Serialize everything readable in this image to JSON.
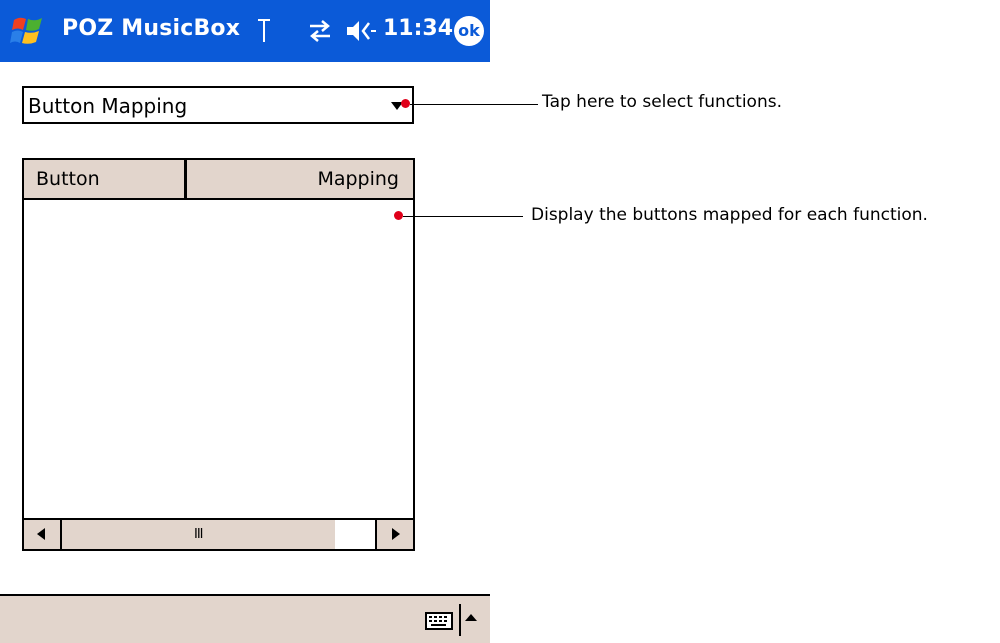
{
  "titlebar": {
    "app_title": "POZ MusicBox",
    "clock": "11:34",
    "ok_label": "ok",
    "icons": [
      "windows-start-icon",
      "antenna-icon",
      "connection-icon",
      "speaker-icon"
    ]
  },
  "function_select": {
    "selected": "Button Mapping"
  },
  "list": {
    "columns": [
      "Button",
      "Mapping"
    ],
    "rows": []
  },
  "scrollbar": {
    "grip": "III"
  },
  "menubar": {
    "icons": [
      "keyboard-icon",
      "sip-arrow-icon"
    ]
  },
  "annotations": [
    {
      "text": "Tap here to select functions."
    },
    {
      "text": "Display the buttons mapped for each function."
    }
  ],
  "colors": {
    "titlebar": "#0b5ad8",
    "chrome": "#e2d5cc",
    "callout_dot": "#e0001a"
  }
}
